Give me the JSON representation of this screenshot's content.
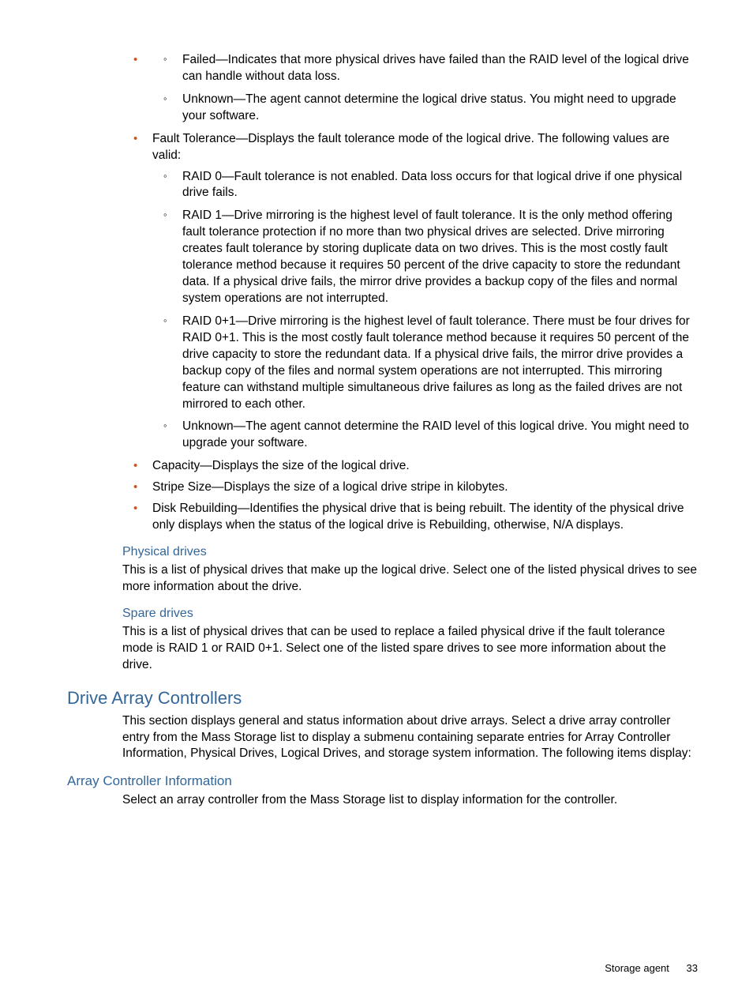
{
  "topList": {
    "statusSub": [
      "Failed—Indicates that more physical drives have failed than the RAID level of the logical drive can handle without data loss.",
      "Unknown—The agent cannot determine the logical drive status. You might need to upgrade your software."
    ],
    "faultTolerance": "Fault Tolerance—Displays the fault tolerance mode of the logical drive. The following values are valid:",
    "faultToleranceSub": [
      "RAID 0—Fault tolerance is not enabled. Data loss occurs for that logical drive if one physical drive fails.",
      "RAID 1—Drive mirroring is the highest level of fault tolerance. It is the only method offering fault tolerance protection if no more than two physical drives are selected. Drive mirroring creates fault tolerance by storing duplicate data on two drives. This is the most costly fault tolerance method because it requires 50 percent of the drive capacity to store the redundant data. If a physical drive fails, the mirror drive provides a backup copy of the files and normal system operations are not interrupted.",
      "RAID 0+1—Drive mirroring is the highest level of fault tolerance. There must be four drives for RAID 0+1. This is the most costly fault tolerance method because it requires 50 percent of the drive capacity to store the redundant data. If a physical drive fails, the mirror drive provides a backup copy of the files and normal system operations are not interrupted. This mirroring feature can withstand multiple simultaneous drive failures as long as the failed drives are not mirrored to each other.",
      "Unknown—The agent cannot determine the RAID level of this logical drive. You might need to upgrade your software."
    ],
    "capacity": "Capacity—Displays the size of the logical drive.",
    "stripeSize": "Stripe Size—Displays the size of a logical drive stripe in kilobytes.",
    "diskRebuilding": "Disk Rebuilding—Identifies the physical drive that is being rebuilt. The identity of the physical drive only displays when the status of the logical drive is Rebuilding, otherwise, N/A displays."
  },
  "physicalDrives": {
    "heading": "Physical drives",
    "text": "This is a list of physical drives that make up the logical drive. Select one of the listed physical drives to see more information about the drive."
  },
  "spareDrives": {
    "heading": "Spare drives",
    "text": "This is a list of physical drives that can be used to replace a failed physical drive if the fault tolerance mode is RAID 1 or RAID 0+1. Select one of the listed spare drives to see more information about the drive."
  },
  "driveArray": {
    "heading": "Drive Array Controllers",
    "text": "This section displays general and status information about drive arrays. Select a drive array controller entry from the Mass Storage list to display a submenu containing separate entries for Array Controller Information, Physical Drives, Logical Drives, and storage system information. The following items display:"
  },
  "arrayController": {
    "heading": "Array Controller Information",
    "text": "Select an array controller from the Mass Storage list to display information for the controller."
  },
  "footer": {
    "label": "Storage agent",
    "page": "33"
  }
}
